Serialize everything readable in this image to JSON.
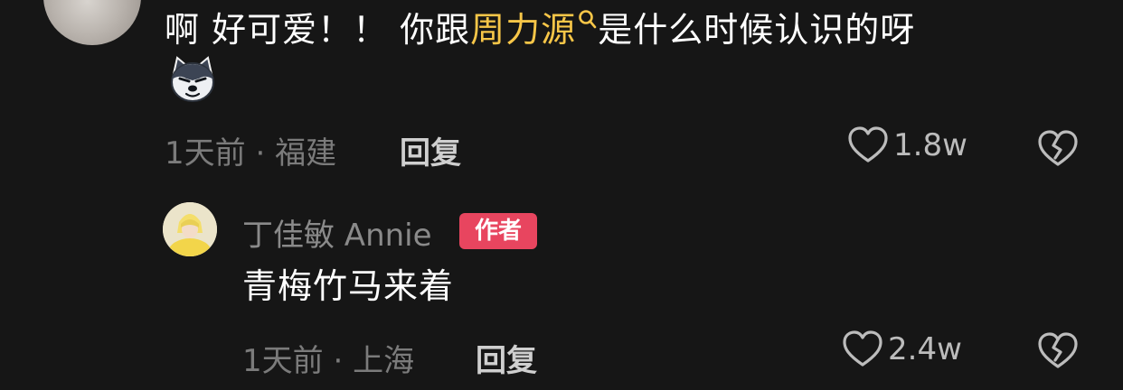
{
  "comment": {
    "text_before": "啊 好可爱！！ 你跟",
    "topic": "周力源",
    "text_after": "是什么时候认识的呀",
    "emoji": "dog-emoji",
    "time": "1天前",
    "separator": "·",
    "location": "福建",
    "reply_label": "回复",
    "like_count": "1.8w"
  },
  "reply": {
    "username": "丁佳敏 Annie",
    "badge": "作者",
    "text": "青梅竹马来着",
    "time": "1天前",
    "separator": "·",
    "location": "上海",
    "reply_label": "回复",
    "like_count": "2.4w"
  },
  "icons": {
    "like": "heart-outline-icon",
    "dislike": "broken-heart-icon",
    "search": "search-icon"
  },
  "colors": {
    "background": "#161616",
    "topic_link": "#f7c648",
    "author_badge": "#e8455f",
    "meta_text": "#7b7b7b"
  }
}
